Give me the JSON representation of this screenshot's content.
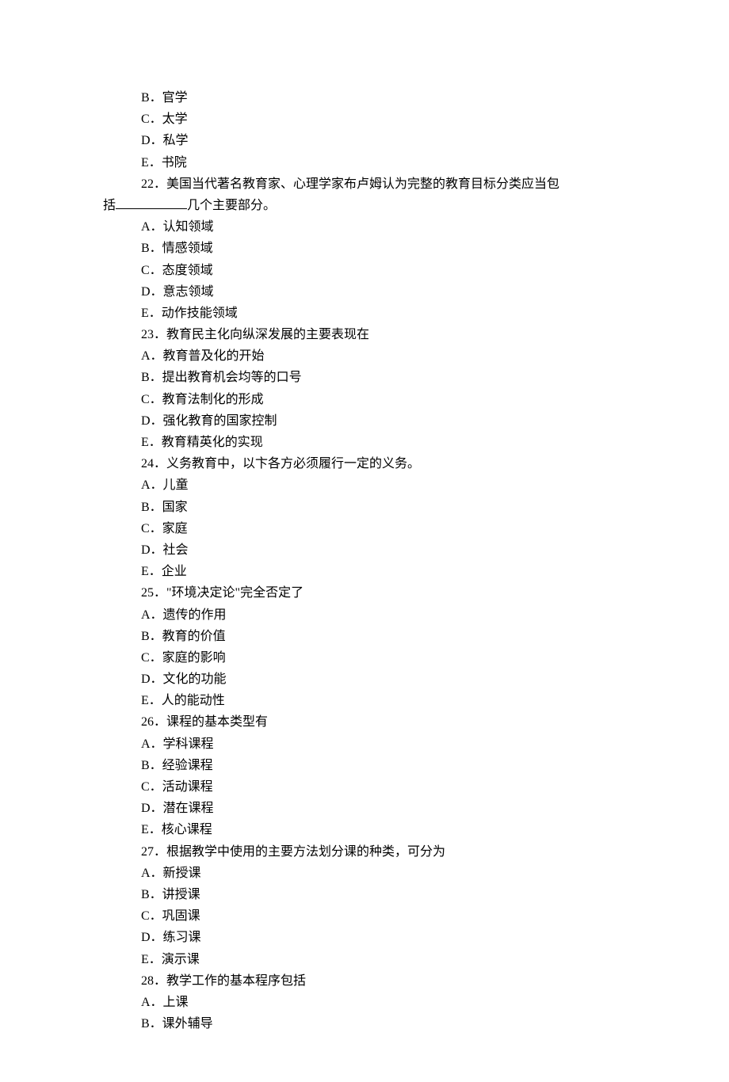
{
  "q21_options_tail": [
    "B．官学",
    "C．太学",
    "D．私学",
    "E．书院"
  ],
  "q22": {
    "stem_line1": "22．美国当代著名教育家、心理学家布卢姆认为完整的教育目标分类应当包",
    "stem_line2_prefix": "括",
    "stem_line2_suffix": "几个主要部分。",
    "options": [
      "A．认知领域",
      "B．情感领域",
      "C．态度领域",
      "D．意志领域",
      "E．动作技能领域"
    ]
  },
  "q23": {
    "stem": "23．教育民主化向纵深发展的主要表现在",
    "options": [
      "A．教育普及化的开始",
      "B．提出教育机会均等的口号",
      "C．教育法制化的形成",
      "D．强化教育的国家控制",
      "E．教育精英化的实现"
    ]
  },
  "q24": {
    "stem": "24．义务教育中，以卞各方必须履行一定的义务。",
    "options": [
      "A．儿童",
      "B．国家",
      "C．家庭",
      "D．社会",
      "E．企业"
    ]
  },
  "q25": {
    "stem": "25．\"环境决定论\"完全否定了",
    "options": [
      "A．遗传的作用",
      "B．教育的价值",
      "C．家庭的影响",
      "D．文化的功能",
      "E．人的能动性"
    ]
  },
  "q26": {
    "stem": "26．课程的基本类型有",
    "options": [
      "A．学科课程",
      "B．经验课程",
      "C．活动课程",
      "D．潜在课程",
      "E．核心课程"
    ]
  },
  "q27": {
    "stem": "27．根据教学中使用的主要方法划分课的种类，可分为",
    "options": [
      "A．新授课",
      "B．讲授课",
      "C．巩固课",
      "D．练习课",
      "E．演示课"
    ]
  },
  "q28": {
    "stem": "28．教学工作的基本程序包括",
    "options": [
      "A．上课",
      "B．课外辅导"
    ]
  }
}
